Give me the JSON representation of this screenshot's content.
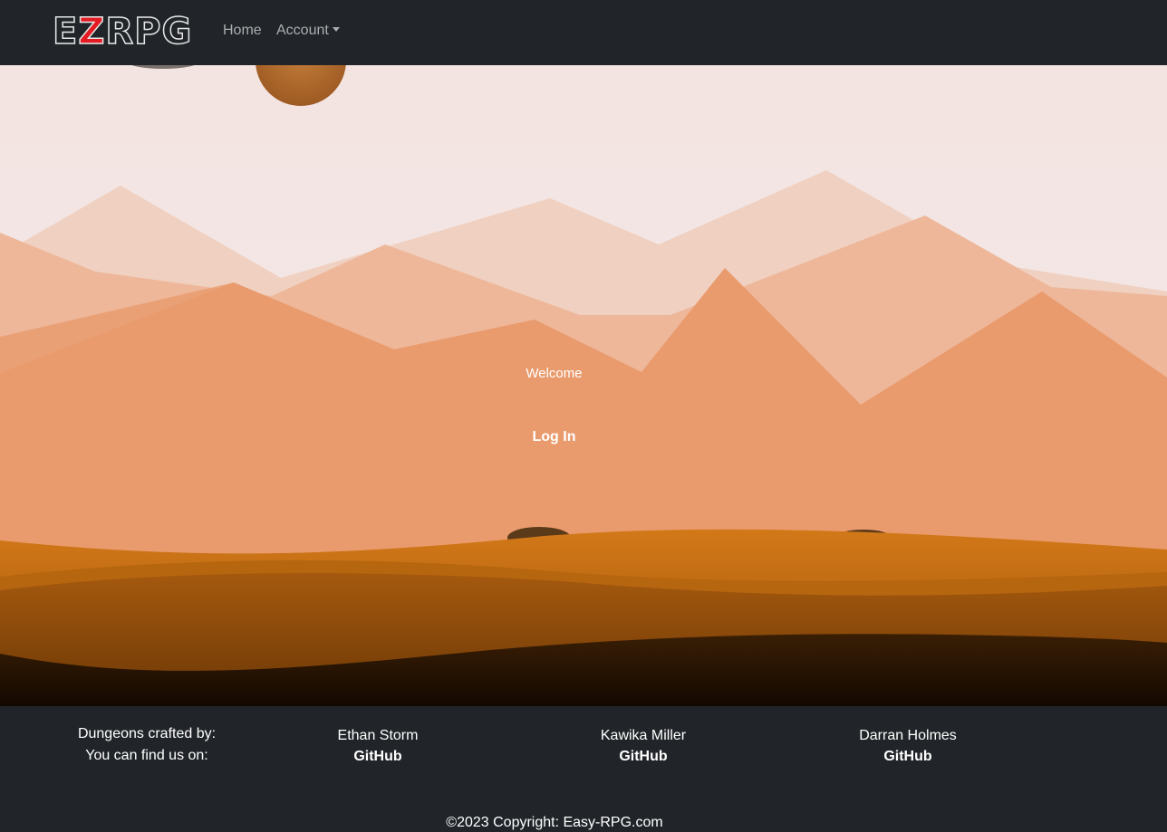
{
  "brand": {
    "logo_text_a": "E",
    "logo_text_z": "Z",
    "logo_text_b": "RPG"
  },
  "nav": {
    "home": "Home",
    "account": "Account"
  },
  "hero": {
    "welcome": "Welcome",
    "login": "Log In"
  },
  "footer": {
    "crafted_by": "Dungeons crafted by:",
    "find_us": "You can find us on:",
    "developers": [
      {
        "name": "Ethan Storm",
        "link": "GitHub"
      },
      {
        "name": "Kawika Miller",
        "link": "GitHub"
      },
      {
        "name": "Darran Holmes",
        "link": "GitHub"
      }
    ],
    "copyright": "©2023 Copyright: Easy-RPG.com"
  },
  "colors": {
    "navbar": "#212529",
    "logo_accent": "#e41b23",
    "sky": "#f3e7e6",
    "sand": "#e8945a"
  }
}
